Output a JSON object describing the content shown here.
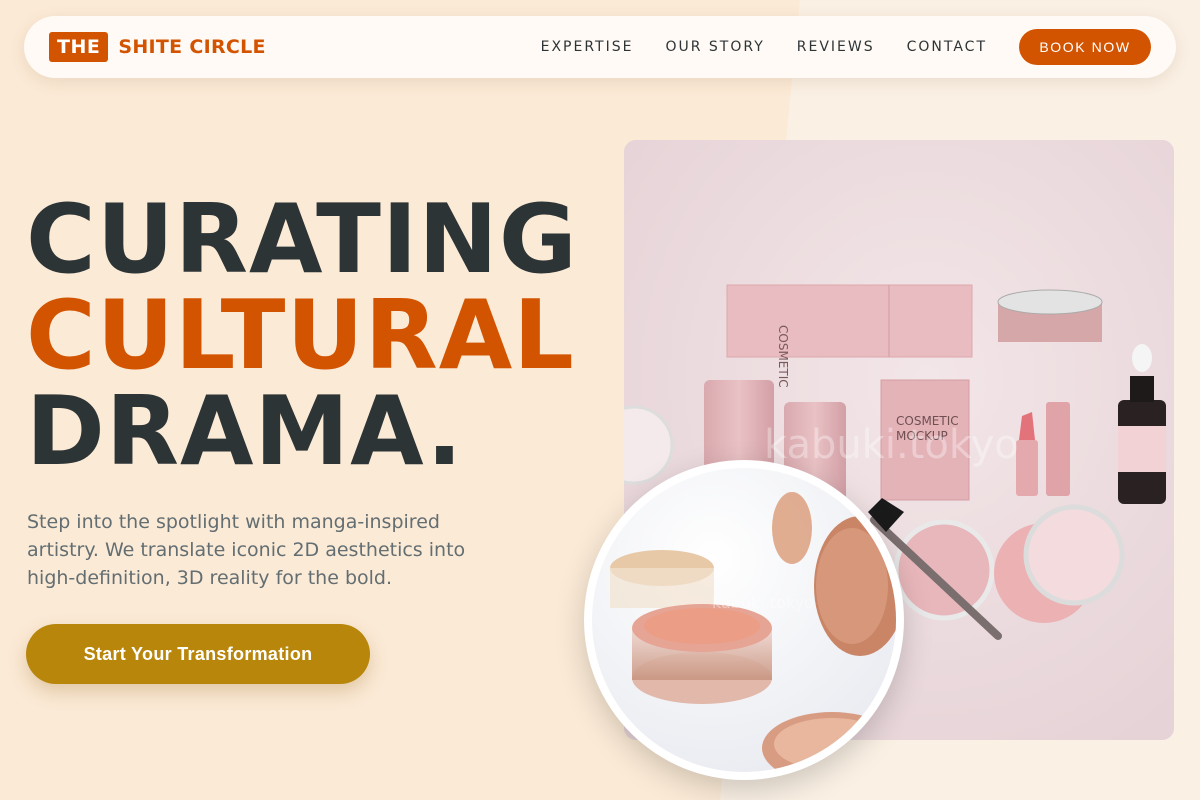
{
  "brand": {
    "mark": "THE",
    "name": "SHITE CIRCLE"
  },
  "nav": {
    "links": [
      "EXPERTISE",
      "OUR STORY",
      "REVIEWS",
      "CONTACT"
    ],
    "cta": "BOOK NOW"
  },
  "hero": {
    "line1": "CURATING",
    "line2": "CULTURAL",
    "line3": "DRAMA.",
    "subtitle": "Step into the spotlight with manga-inspired artistry. We translate iconic 2D aesthetics into high-definition, 3D reality for the bold.",
    "cta": "Start Your Transformation"
  },
  "images": {
    "main_watermark": "kabuki.tokyo",
    "circle_watermark": "kabuki.tokyo",
    "main_alt": "Cosmetic product mockups on pink background",
    "circle_alt": "Loose powder jar close-up"
  },
  "colors": {
    "accent": "#d35400",
    "dark": "#2d3436",
    "gold": "#b8860b",
    "bg": "#fbead6"
  }
}
